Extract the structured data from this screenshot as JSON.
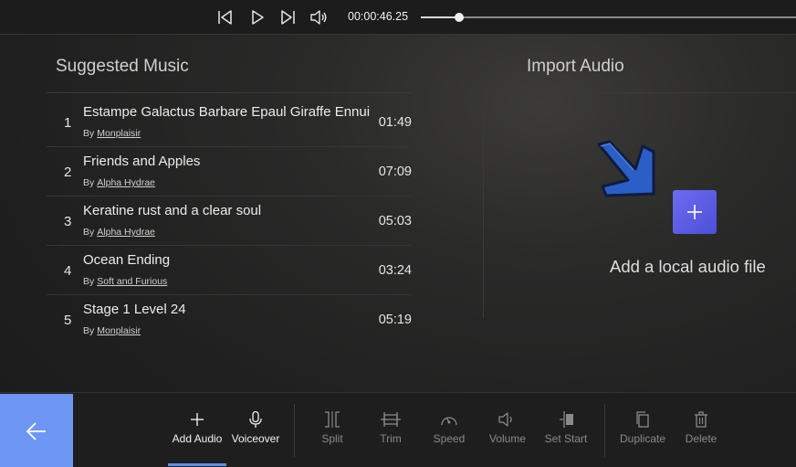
{
  "player": {
    "time": "00:00:46.25",
    "progress": 0.103,
    "icons": [
      "skip-back-icon",
      "play-icon",
      "skip-forward-icon",
      "volume-icon"
    ]
  },
  "suggested": {
    "heading": "Suggested Music",
    "by_label": "By",
    "tracks": [
      {
        "num": "1",
        "title": "Estampe Galactus Barbare Epaul Giraffe Ennui",
        "artist": "Monplaisir",
        "duration": "01:49"
      },
      {
        "num": "2",
        "title": "Friends and Apples",
        "artist": "Alpha Hydrae",
        "duration": "07:09"
      },
      {
        "num": "3",
        "title": "Keratine rust and a clear soul",
        "artist": "Alpha Hydrae",
        "duration": "05:03"
      },
      {
        "num": "4",
        "title": "Ocean Ending",
        "artist": "Soft and Furious",
        "duration": "03:24"
      },
      {
        "num": "5",
        "title": "Stage 1 Level 24",
        "artist": "Monplaisir",
        "duration": "05:19"
      }
    ]
  },
  "import": {
    "heading": "Import Audio",
    "add_label": "Add a local audio file"
  },
  "toolbar": {
    "add_audio": "Add Audio",
    "voiceover": "Voiceover",
    "split": "Split",
    "trim": "Trim",
    "speed": "Speed",
    "volume": "Volume",
    "set_start": "Set Start",
    "duplicate": "Duplicate",
    "delete": "Delete"
  },
  "colors": {
    "accent": "#6e96f5",
    "add_button": "#5b5ce6",
    "arrow": "#2b5fc7",
    "underline": "#5b8df0"
  }
}
